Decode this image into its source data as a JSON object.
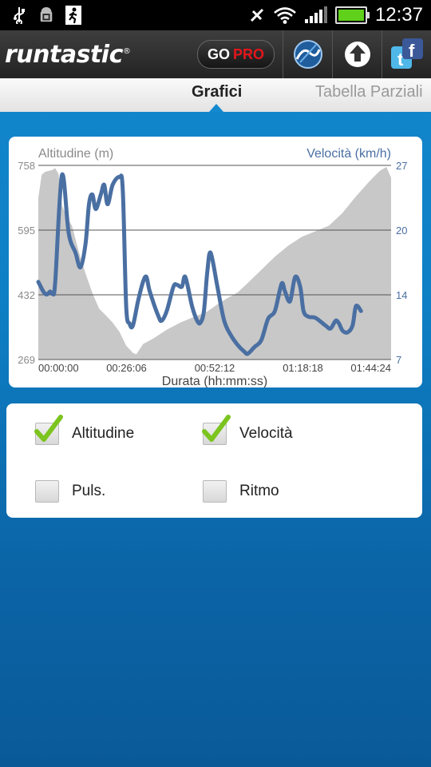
{
  "status_bar": {
    "time": "12:37",
    "left_icons": [
      "usb-icon",
      "android-debug-icon",
      "runner-notification-icon"
    ],
    "right_icons": [
      "silent-icon",
      "wifi-icon",
      "signal-icon",
      "battery-icon"
    ],
    "battery_level": 1.0
  },
  "app_bar": {
    "logo_text": "runtastic",
    "logo_mark": "®",
    "go_label": "GO",
    "pro_label": "PRO",
    "actions": [
      "routes-icon",
      "upload-icon",
      "social-share-icon"
    ]
  },
  "tabs": [
    {
      "label": "Grafici",
      "active": true
    },
    {
      "label": "Tabella Parziali",
      "active": false
    }
  ],
  "chart_data": {
    "type": "area",
    "x_axis_label": "Durata (hh:mm:ss)",
    "x_tick_labels": [
      "00:00:00",
      "00:26:06",
      "00:52:12",
      "01:18:18",
      "01:44:24"
    ],
    "x_ticks_minutes": [
      0,
      26.1,
      52.2,
      78.3,
      104.4
    ],
    "x_range_minutes": [
      0,
      104.4
    ],
    "left_axis_label": "Altitudine (m)",
    "left_ticks": [
      "758",
      "595",
      "432",
      "269"
    ],
    "left_range": [
      269,
      758
    ],
    "right_axis_label": "Velocità (km/h)",
    "right_ticks": [
      "27",
      "20",
      "14",
      "7"
    ],
    "right_range": [
      7,
      27
    ],
    "grid": true,
    "series": [
      {
        "name": "Altitudine (m)",
        "axis": "left",
        "style": "filled-area",
        "color": "#c8c8c8",
        "points": [
          [
            0,
            676
          ],
          [
            1,
            734
          ],
          [
            2,
            742
          ],
          [
            4,
            746
          ],
          [
            5,
            751
          ],
          [
            6,
            736
          ],
          [
            7,
            658
          ],
          [
            8,
            636
          ],
          [
            10,
            605
          ],
          [
            12,
            540
          ],
          [
            14,
            485
          ],
          [
            16,
            437
          ],
          [
            18,
            397
          ],
          [
            20,
            380
          ],
          [
            22,
            362
          ],
          [
            24,
            339
          ],
          [
            26,
            304
          ],
          [
            28,
            286
          ],
          [
            29,
            282
          ],
          [
            31,
            308
          ],
          [
            34,
            322
          ],
          [
            38,
            344
          ],
          [
            42,
            362
          ],
          [
            46,
            376
          ],
          [
            50,
            390
          ],
          [
            53,
            408
          ],
          [
            56,
            424
          ],
          [
            59,
            438
          ],
          [
            62,
            462
          ],
          [
            66,
            495
          ],
          [
            70,
            528
          ],
          [
            74,
            556
          ],
          [
            78,
            578
          ],
          [
            82,
            592
          ],
          [
            86,
            606
          ],
          [
            90,
            638
          ],
          [
            94,
            680
          ],
          [
            98,
            718
          ],
          [
            101,
            744
          ],
          [
            103,
            754
          ],
          [
            104.4,
            727
          ]
        ]
      },
      {
        "name": "Velocità (km/h)",
        "axis": "right",
        "style": "line",
        "color": "#4a6fa2",
        "points": [
          [
            0,
            15
          ],
          [
            1.5,
            14
          ],
          [
            2.5,
            13.7
          ],
          [
            3.5,
            14
          ],
          [
            4.3,
            13.8
          ],
          [
            5,
            15
          ],
          [
            7,
            26
          ],
          [
            9,
            20
          ],
          [
            11,
            18
          ],
          [
            12.5,
            16.5
          ],
          [
            14,
            19
          ],
          [
            15,
            23
          ],
          [
            16,
            24
          ],
          [
            17,
            22.5
          ],
          [
            18.5,
            24
          ],
          [
            19.5,
            25
          ],
          [
            20.5,
            23
          ],
          [
            22,
            25
          ],
          [
            24,
            25.8
          ],
          [
            25,
            24.5
          ],
          [
            26,
            12.5
          ],
          [
            27,
            10.7
          ],
          [
            28,
            10.5
          ],
          [
            29.5,
            13
          ],
          [
            31,
            15
          ],
          [
            32,
            15.5
          ],
          [
            33,
            14
          ],
          [
            35.5,
            11.5
          ],
          [
            36.5,
            11
          ],
          [
            38,
            12
          ],
          [
            40,
            14.5
          ],
          [
            41,
            14.7
          ],
          [
            42.5,
            14.5
          ],
          [
            43.5,
            15.5
          ],
          [
            45.5,
            12.5
          ],
          [
            47,
            11
          ],
          [
            48,
            10.8
          ],
          [
            49,
            12
          ],
          [
            50,
            16
          ],
          [
            51,
            18
          ],
          [
            53,
            14.5
          ],
          [
            55,
            11
          ],
          [
            57,
            9.5
          ],
          [
            59,
            8.5
          ],
          [
            61,
            7.8
          ],
          [
            62,
            7.6
          ],
          [
            64,
            8.3
          ],
          [
            66,
            9
          ],
          [
            68,
            11.2
          ],
          [
            70,
            12
          ],
          [
            72,
            14.8
          ],
          [
            73,
            14
          ],
          [
            74.5,
            13
          ],
          [
            76,
            15.5
          ],
          [
            77.5,
            14.5
          ],
          [
            78.5,
            12
          ],
          [
            80,
            11.4
          ],
          [
            82,
            11.3
          ],
          [
            85,
            10.5
          ],
          [
            86.5,
            10.2
          ],
          [
            88,
            11
          ],
          [
            89,
            10.7
          ],
          [
            90,
            10
          ],
          [
            91.5,
            9.8
          ],
          [
            93,
            10.5
          ],
          [
            94,
            12.5
          ],
          [
            95.5,
            12
          ]
        ]
      }
    ]
  },
  "checkboxes": [
    {
      "label": "Altitudine",
      "checked": true
    },
    {
      "label": "Velocità",
      "checked": true
    },
    {
      "label": "Puls.",
      "checked": false
    },
    {
      "label": "Ritmo",
      "checked": false
    }
  ],
  "colors": {
    "background_blue": "#1389cf",
    "check_green": "#7cc41f",
    "speed_line": "#4a6fa2",
    "altitude_fill": "#c8c8c8",
    "pro_red": "#e3161c"
  }
}
